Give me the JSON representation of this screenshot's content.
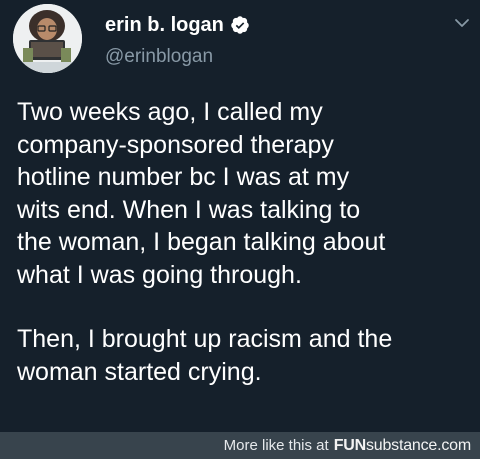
{
  "author": {
    "display_name": "erin b. logan",
    "handle": "@erinblogan",
    "verified": true,
    "avatar_icon": "profile-photo-avatar"
  },
  "menu": {
    "icon": "chevron-down-icon"
  },
  "tweet": {
    "paragraphs": [
      {
        "lines": [
          "Two weeks ago, I called my",
          "company-sponsored therapy",
          "hotline number bc I was at my",
          "wits end. When I was talking to",
          "the woman, I began talking about",
          "what I was going through."
        ]
      },
      {
        "lines": [
          "Then, I brought up racism and the",
          "woman started crying."
        ]
      }
    ]
  },
  "watermark": {
    "text": "More like this at",
    "brand_part1": "FUN",
    "brand_part2": "substance.com"
  },
  "colors": {
    "background": "#15202b",
    "text": "#ffffff",
    "secondary_text": "#8899a6",
    "verified_badge": "#ffffff",
    "watermark_bar": "#38444d"
  }
}
